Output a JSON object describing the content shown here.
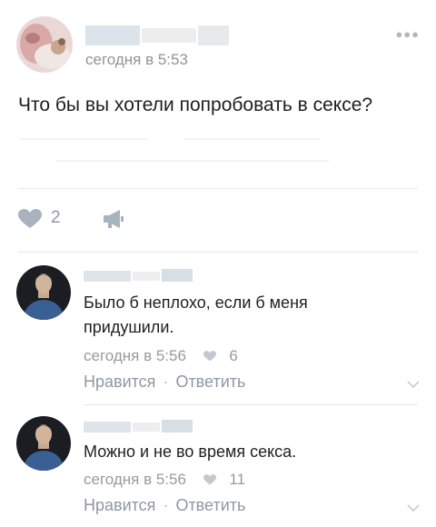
{
  "post": {
    "time": "сегодня в 5:53",
    "text": "Что бы вы хотели попробовать в сексе?",
    "likes": "2",
    "more_icon": "more-dots-icon",
    "like_icon": "heart-icon",
    "share_icon": "megaphone-icon"
  },
  "comments": [
    {
      "text": "Было б неплохо, если б меня придушили.",
      "time": "сегодня в 5:56",
      "likes": "6",
      "like_label": "Нравится",
      "separator": "·",
      "reply_label": "Ответить"
    },
    {
      "text": "Можно и не во время секса.",
      "time": "сегодня в 5:56",
      "likes": "11",
      "like_label": "Нравится",
      "separator": "·",
      "reply_label": "Ответить"
    }
  ],
  "colors": {
    "accent_gray": "#8f98a3",
    "divider": "#e7e8ec",
    "meta_text": "#939393"
  }
}
